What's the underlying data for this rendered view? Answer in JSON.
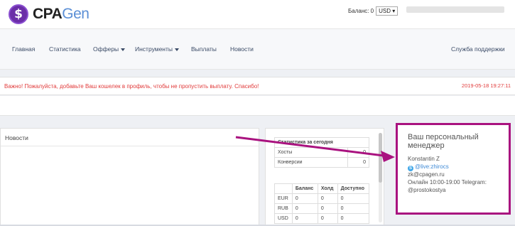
{
  "logo": {
    "badge": "$",
    "part1": "CPA",
    "part2": "Gen"
  },
  "header": {
    "balance_label": "Баланс: 0",
    "currency": "USD ▾"
  },
  "nav": {
    "items": [
      "Главная",
      "Статистика",
      "Офферы",
      "Инструменты",
      "Выплаты",
      "Новости"
    ],
    "support": "Служба поддержки"
  },
  "alert": {
    "text": "Важно! Пожалуйста, добавьте Ваш кошелек в профиль, чтобы не пропустить выплату. Спасибо!",
    "time": "2019-05-18 19:27:11"
  },
  "news": {
    "title": "Новости"
  },
  "stats_today": {
    "title": "Статистика за сегодня",
    "rows": [
      {
        "label": "Хосты",
        "value": "0"
      },
      {
        "label": "Конверсии",
        "value": "0"
      }
    ]
  },
  "balance_table": {
    "headers": [
      "",
      "Баланс",
      "Холд",
      "Доступно"
    ],
    "rows": [
      [
        "EUR",
        "0",
        "0",
        "0"
      ],
      [
        "RUB",
        "0",
        "0",
        "0"
      ],
      [
        "USD",
        "0",
        "0",
        "0"
      ]
    ]
  },
  "manager": {
    "title": "Ваш персональный менеджер",
    "name": "Konstantin Z",
    "skype": "@live:zhirocs",
    "email": "zk@cpagen.ru",
    "hours": "Онлайн 10:00-19:00 Telegram:",
    "telegram": "@prostokostya"
  },
  "colors": {
    "accent": "#a9127f",
    "alert": "#e13b3b",
    "logo": "#6b2ea8"
  }
}
